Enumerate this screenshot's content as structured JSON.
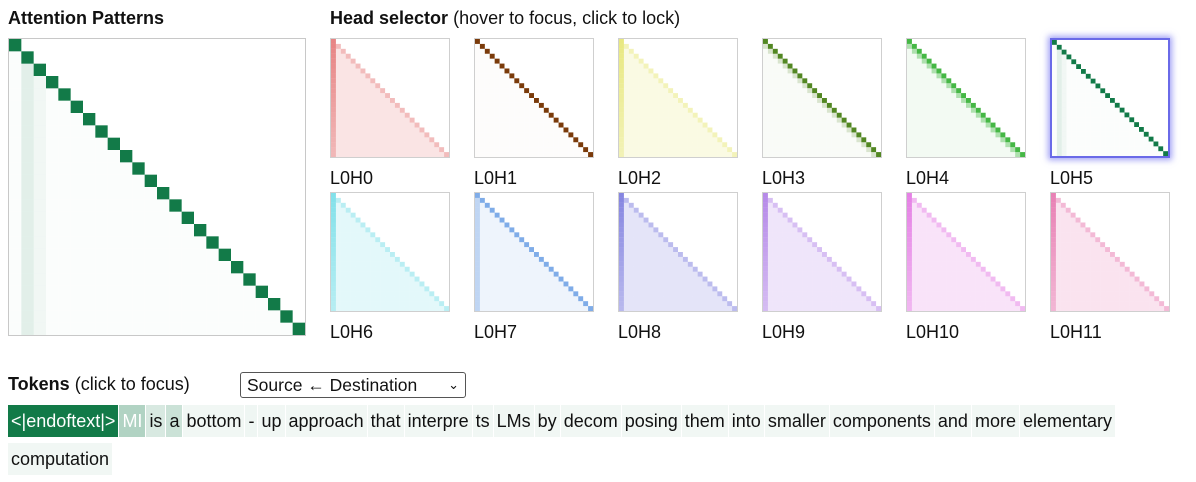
{
  "headings": {
    "attention_patterns": "Attention Patterns",
    "head_selector_bold": "Head selector",
    "head_selector_hint": "(hover to focus, click to lock)",
    "tokens_bold": "Tokens",
    "tokens_hint": "(click to focus)"
  },
  "direction_select": {
    "value": "Source ← Destination"
  },
  "heads": [
    {
      "label": "L0H0",
      "color": "#d42020",
      "selected": false
    },
    {
      "label": "L0H1",
      "color": "#7a3a0a",
      "selected": false
    },
    {
      "label": "L0H2",
      "color": "#d6d61a",
      "selected": false
    },
    {
      "label": "L0H3",
      "color": "#3f7a0a",
      "selected": false
    },
    {
      "label": "L0H4",
      "color": "#16a516",
      "selected": false
    },
    {
      "label": "L0H5",
      "color": "#127a48",
      "selected": true
    },
    {
      "label": "L0H6",
      "color": "#1cc8d8",
      "selected": false
    },
    {
      "label": "L0H7",
      "color": "#2a74d8",
      "selected": false
    },
    {
      "label": "L0H8",
      "color": "#2222c8",
      "selected": false
    },
    {
      "label": "L0H9",
      "color": "#7a2ad6",
      "selected": false
    },
    {
      "label": "L0H10",
      "color": "#d01ad0",
      "selected": false
    },
    {
      "label": "L0H11",
      "color": "#d61a78",
      "selected": false
    }
  ],
  "tokens": [
    {
      "text": "<|endoftext|>",
      "weight": 1.0
    },
    {
      "text": "MI",
      "weight": 0.6
    },
    {
      "text": " is",
      "weight": 0.3
    },
    {
      "text": " a",
      "weight": 0.4
    },
    {
      "text": " bottom",
      "weight": 0.1
    },
    {
      "text": "-",
      "weight": 0.12
    },
    {
      "text": "up",
      "weight": 0.08
    },
    {
      "text": " approach",
      "weight": 0.04
    },
    {
      "text": " that",
      "weight": 0.04
    },
    {
      "text": " interpre",
      "weight": 0.05
    },
    {
      "text": "ts",
      "weight": 0.05
    },
    {
      "text": " LMs",
      "weight": 0.05
    },
    {
      "text": " by",
      "weight": 0.04
    },
    {
      "text": " decom",
      "weight": 0.05
    },
    {
      "text": "posing",
      "weight": 0.05
    },
    {
      "text": " them",
      "weight": 0.06
    },
    {
      "text": " into",
      "weight": 0.04
    },
    {
      "text": " smaller",
      "weight": 0.04
    },
    {
      "text": " components",
      "weight": 0.04
    },
    {
      "text": " and",
      "weight": 0.1
    },
    {
      "text": " more",
      "weight": 0.05
    },
    {
      "text": " elementary",
      "weight": 0.04
    },
    {
      "text": " computation",
      "weight": 0.04
    }
  ],
  "focus_color": "#127a48"
}
